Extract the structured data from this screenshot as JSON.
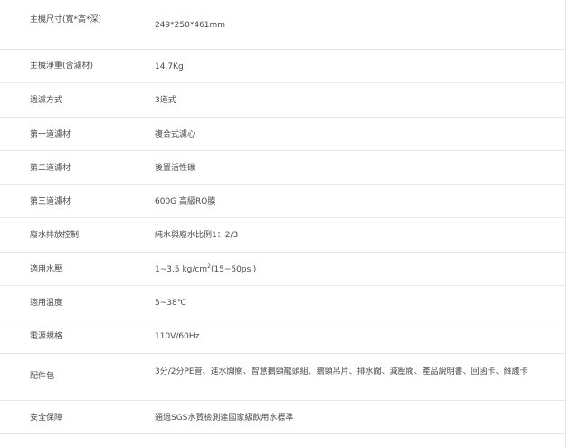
{
  "specs": {
    "rows": [
      {
        "label": "主機尺寸(寬*高*深)",
        "value": "249*250*461mm"
      },
      {
        "label": "主機淨重(含濾材)",
        "value": "14.7Kg"
      },
      {
        "label": "過濾方式",
        "value": "3道式"
      },
      {
        "label": "第一道濾材",
        "value": "複合式濾心"
      },
      {
        "label": "第二道濾材",
        "value": "後置活性碳"
      },
      {
        "label": "第三道濾材",
        "value": "600G 高級RO膜"
      },
      {
        "label": "廢水排放控制",
        "value": "純水與廢水比例1：2/3"
      },
      {
        "label": "適用水壓",
        "value_main": "1~3.5 kg/cm",
        "value_sup": "2",
        "value_tail": "(15~50psi)"
      },
      {
        "label": "適用溫度",
        "value": "5~38℃"
      },
      {
        "label": "電源規格",
        "value": "110V/60Hz"
      },
      {
        "label": "配件包",
        "value": "3分/2分PE管、進水開關、智慧鵝頸龍頭組、鵝頸吊片、排水閥、減壓閥、產品說明書、回函卡、維護卡"
      },
      {
        "label": "安全保障",
        "value": "通過SGS水質檢測達國家級飲用水標準"
      }
    ]
  }
}
